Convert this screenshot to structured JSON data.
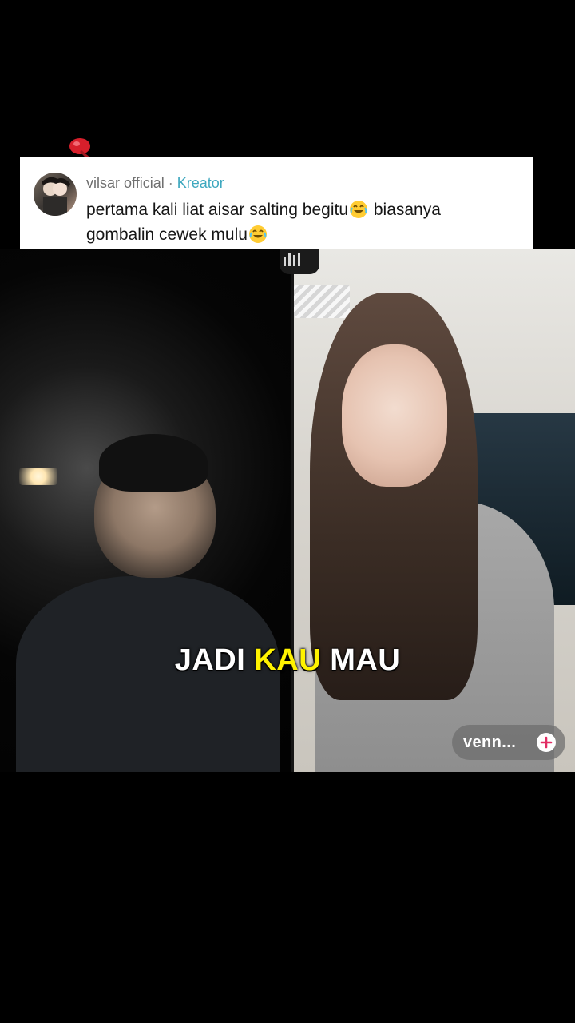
{
  "comment": {
    "author": "vilsar official",
    "separator": "·",
    "badge": "Kreator",
    "text_line_1_prefix": "pertama kali liat aisar salting begitu",
    "text_line_1_suffix": " biasanya",
    "text_line_2": "gombalin cewek mulu",
    "emoji": "laughing-tears-emoji"
  },
  "video": {
    "caption": {
      "before": "JADI ",
      "highlight": "KAU",
      "after": " MAU"
    },
    "guest_label": "venn...",
    "follow_icon": "plus-icon"
  },
  "colors": {
    "badge": "#3ea8bf",
    "caption_highlight": "#fff200",
    "background": "#000000",
    "comment_bg": "#ffffff"
  }
}
